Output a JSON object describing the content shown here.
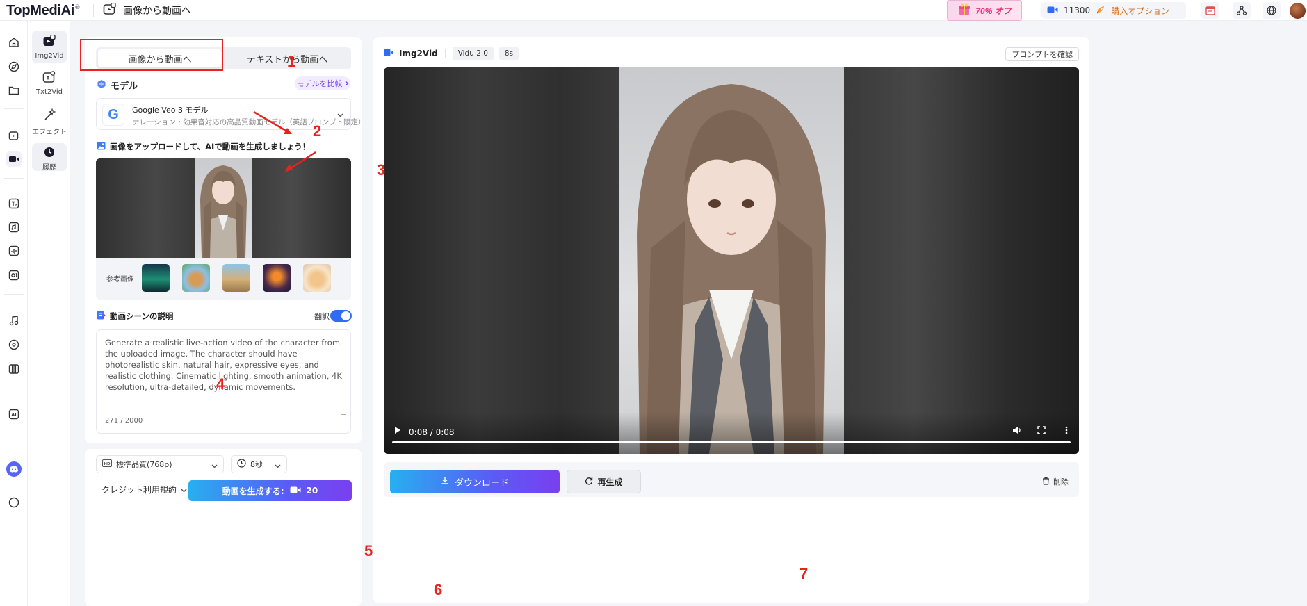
{
  "header": {
    "logo": "TopMediAi",
    "logo_mark": "®",
    "page_title": "画像から動画へ",
    "promo": "70% オフ",
    "credits": "11300",
    "buy_option": "購入オプション"
  },
  "subnav": {
    "items": [
      {
        "label": "Img2Vid"
      },
      {
        "label": "Txt2Vid"
      },
      {
        "label": "エフェクト"
      },
      {
        "label": "履歴"
      }
    ]
  },
  "left": {
    "tabs": {
      "image_to_video": "画像から動画へ",
      "text_to_video": "テキストから動画へ"
    },
    "model": {
      "section_title": "モデル",
      "compare": "モデルを比較",
      "name": "Google Veo 3 モデル",
      "description": "ナレーション・効果音対応の高品質動画モデル（英語プロンプト限定）"
    },
    "upload": {
      "title": "画像をアップロードして、AIで動画を生成しましょう！",
      "reference_label": "参考画像"
    },
    "scene": {
      "title": "動画シーンの説明",
      "translate": "翻訳",
      "translate_on": true,
      "prompt": "Generate a realistic live-action video of the character from the uploaded image. The character should have photorealistic skin, natural hair, expressive eyes, and realistic clothing. Cinematic lighting, smooth animation, 4K resolution, ultra-detailed, dynamic movements.",
      "count": "271 / 2000"
    },
    "settings": {
      "quality": "標準品質(768p)",
      "duration": "8秒",
      "credit_terms": "クレジット利用規約",
      "generate": "動画を生成する:",
      "cost": "20"
    }
  },
  "right": {
    "title": "Img2Vid",
    "model_pill": "Vidu 2.0",
    "duration_pill": "8s",
    "confirm_prompt": "プロンプトを確認",
    "video": {
      "time": "0:08 / 0:08",
      "progress": 1.0
    },
    "download": "ダウンロード",
    "regenerate": "再生成",
    "delete": "削除"
  },
  "annotations": [
    "1",
    "2",
    "3",
    "4",
    "5",
    "6",
    "7"
  ],
  "colors": {
    "accent_red": "#e8231f",
    "brand_blue": "#2f6bf5",
    "gradient_start": "#27b0f0",
    "gradient_end": "#7a3ff0"
  }
}
